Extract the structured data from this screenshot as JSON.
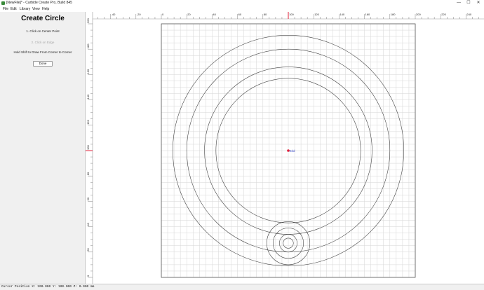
{
  "window": {
    "title": "[NewFile]* - Carbide Create Pro, Build 845",
    "controls": [
      "—",
      "☐",
      "✕"
    ]
  },
  "menu": [
    "File",
    "Edit",
    "Library",
    "View",
    "Help"
  ],
  "panel": {
    "title": "Create Circle",
    "step1": "1. Click on Center Point",
    "step2": "2. Click on Edge",
    "hint": "Hold Shift to Draw From Corner to Corner",
    "done_label": "Done"
  },
  "canvas": {
    "x_ticks": [
      -40,
      -20,
      0,
      20,
      40,
      60,
      80,
      100,
      120,
      140,
      160,
      180,
      200,
      220,
      240
    ],
    "y_ticks": [
      0,
      20,
      40,
      60,
      80,
      100,
      120,
      140,
      160,
      180,
      200
    ],
    "stock": {
      "x": [
        0,
        200
      ],
      "y": [
        0,
        200
      ]
    },
    "grid_spacing": 5,
    "cursor": {
      "x": 100,
      "y": 100
    },
    "cursor_label": "Grid",
    "circles": [
      {
        "cx": 100,
        "cy": 100,
        "r": 91
      },
      {
        "cx": 100,
        "cy": 100,
        "r": 80
      },
      {
        "cx": 100,
        "cy": 100,
        "r": 66
      },
      {
        "cx": 100,
        "cy": 100,
        "r": 57
      },
      {
        "cx": 100,
        "cy": 27,
        "r": 17
      },
      {
        "cx": 100,
        "cy": 27,
        "r": 12
      },
      {
        "cx": 100,
        "cy": 27,
        "r": 7
      },
      {
        "cx": 100,
        "cy": 27,
        "r": 4
      }
    ],
    "colors": {
      "stock_border": "#555555",
      "grid": "#d6d6d6",
      "circle": "#444444",
      "cursor_marker": "#e0203a",
      "cursor_text": "#3040c0",
      "ruler_marker": "#e0203a"
    }
  },
  "status": {
    "text": "Cursor Position X: 100.000 Y: 100.000 Z: 0.000 mm"
  }
}
